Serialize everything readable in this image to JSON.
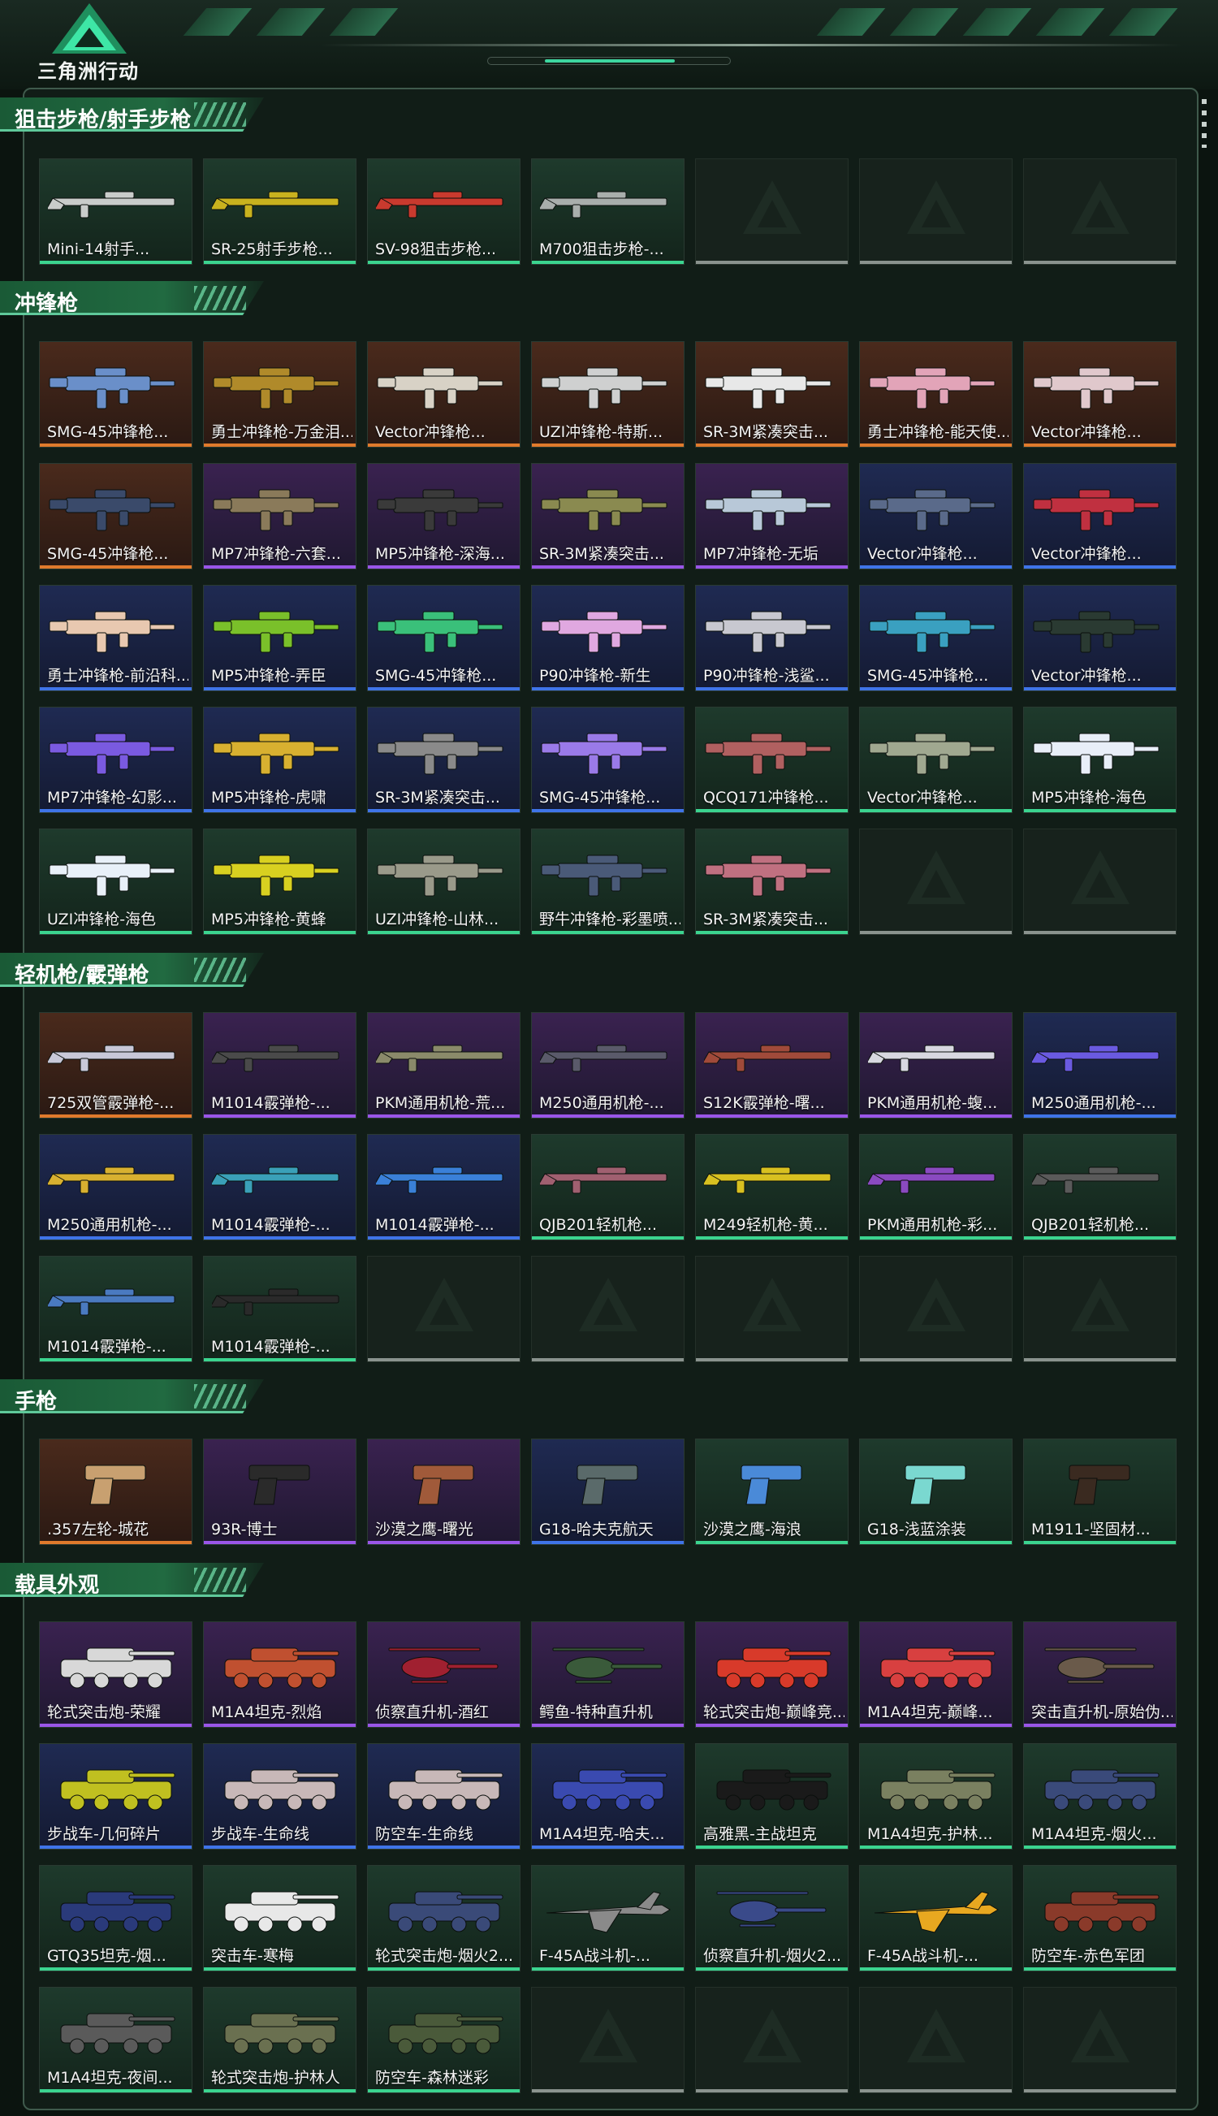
{
  "app": {
    "brand": "三角洲行动",
    "logo_icon": "delta-triangle-logo-icon"
  },
  "colors": {
    "accent": "#3bd48f",
    "orange": "#e07a2c",
    "purple": "#9a56e8",
    "blue": "#3f74e8",
    "green": "#3bd48f"
  },
  "sections": [
    {
      "title": "狙击步枪/射手步枪",
      "items": [
        {
          "name": "Mini-14射手...",
          "rarity": "green",
          "kind": "rifle",
          "color": "#c9ccca"
        },
        {
          "name": "SR-25射手步枪...",
          "rarity": "green",
          "kind": "rifle",
          "color": "#c9b21e"
        },
        {
          "name": "SV-98狙击步枪...",
          "rarity": "green",
          "kind": "rifle",
          "color": "#c93a2e"
        },
        {
          "name": "M700狙击步枪-...",
          "rarity": "green",
          "kind": "rifle",
          "color": "#a9aeac"
        },
        {
          "name": "",
          "rarity": "empty"
        },
        {
          "name": "",
          "rarity": "empty"
        },
        {
          "name": "",
          "rarity": "empty"
        }
      ]
    },
    {
      "title": "冲锋枪",
      "items": [
        {
          "name": "SMG-45冲锋枪...",
          "rarity": "orange",
          "kind": "smg",
          "color": "#6a8fc9"
        },
        {
          "name": "勇士冲锋枪-万金泪...",
          "rarity": "orange",
          "kind": "smg",
          "color": "#b08a2a"
        },
        {
          "name": "Vector冲锋枪...",
          "rarity": "orange",
          "kind": "smg",
          "color": "#d8d2c6"
        },
        {
          "name": "UZI冲锋枪-特斯...",
          "rarity": "orange",
          "kind": "smg",
          "color": "#cfd0d0"
        },
        {
          "name": "SR-3M紧凑突击...",
          "rarity": "orange",
          "kind": "smg",
          "color": "#e8e8e8"
        },
        {
          "name": "勇士冲锋枪-能天使...",
          "rarity": "orange",
          "kind": "smg",
          "color": "#e2a4b8"
        },
        {
          "name": "Vector冲锋枪...",
          "rarity": "orange",
          "kind": "smg",
          "color": "#e0c8cc"
        },
        {
          "name": "SMG-45冲锋枪...",
          "rarity": "orange",
          "kind": "smg",
          "color": "#3a4a6a"
        },
        {
          "name": "MP7冲锋枪-六套...",
          "rarity": "purple",
          "kind": "smg",
          "color": "#8a7a5a"
        },
        {
          "name": "MP5冲锋枪-深海...",
          "rarity": "purple",
          "kind": "smg",
          "color": "#3a3a3a"
        },
        {
          "name": "SR-3M紧凑突击...",
          "rarity": "purple",
          "kind": "smg",
          "color": "#8a8a50"
        },
        {
          "name": "MP7冲锋枪-无垢",
          "rarity": "purple",
          "kind": "smg",
          "color": "#b8c8d8"
        },
        {
          "name": "Vector冲锋枪...",
          "rarity": "blue",
          "kind": "smg",
          "color": "#5a6a8a"
        },
        {
          "name": "Vector冲锋枪...",
          "rarity": "blue",
          "kind": "smg",
          "color": "#c03040"
        },
        {
          "name": "勇士冲锋枪-前沿科...",
          "rarity": "blue",
          "kind": "smg",
          "color": "#e8c8b0"
        },
        {
          "name": "MP5冲锋枪-弄臣",
          "rarity": "blue",
          "kind": "smg",
          "color": "#7ac02a"
        },
        {
          "name": "SMG-45冲锋枪...",
          "rarity": "blue",
          "kind": "smg",
          "color": "#3ac07a"
        },
        {
          "name": "P90冲锋枪-新生",
          "rarity": "blue",
          "kind": "smg",
          "color": "#e0a8e0"
        },
        {
          "name": "P90冲锋枪-浅鲨...",
          "rarity": "blue",
          "kind": "smg",
          "color": "#c8c8d0"
        },
        {
          "name": "SMG-45冲锋枪...",
          "rarity": "blue",
          "kind": "smg",
          "color": "#3aa0c0"
        },
        {
          "name": "Vector冲锋枪...",
          "rarity": "blue",
          "kind": "smg",
          "color": "#2a3a32"
        },
        {
          "name": "MP7冲锋枪-幻影...",
          "rarity": "blue",
          "kind": "smg",
          "color": "#7a5ae0"
        },
        {
          "name": "MP5冲锋枪-虎啸",
          "rarity": "blue",
          "kind": "smg",
          "color": "#d8b030"
        },
        {
          "name": "SR-3M紧凑突击...",
          "rarity": "blue",
          "kind": "smg",
          "color": "#8a8a8a"
        },
        {
          "name": "SMG-45冲锋枪...",
          "rarity": "blue",
          "kind": "smg",
          "color": "#9a7ae8"
        },
        {
          "name": "QCQ171冲锋枪...",
          "rarity": "green",
          "kind": "smg",
          "color": "#b06060"
        },
        {
          "name": "Vector冲锋枪...",
          "rarity": "green",
          "kind": "smg",
          "color": "#a0a890"
        },
        {
          "name": "MP5冲锋枪-海色",
          "rarity": "green",
          "kind": "smg",
          "color": "#e8eef8"
        },
        {
          "name": "UZI冲锋枪-海色",
          "rarity": "green",
          "kind": "smg",
          "color": "#e8f0f8"
        },
        {
          "name": "MP5冲锋枪-黄蜂",
          "rarity": "green",
          "kind": "smg",
          "color": "#d8d020"
        },
        {
          "name": "UZI冲锋枪-山林...",
          "rarity": "green",
          "kind": "smg",
          "color": "#9a9a8a"
        },
        {
          "name": "野牛冲锋枪-彩墨喷...",
          "rarity": "green",
          "kind": "smg",
          "color": "#4a5a78"
        },
        {
          "name": "SR-3M紧凑突击...",
          "rarity": "green",
          "kind": "smg",
          "color": "#c07080"
        },
        {
          "name": "",
          "rarity": "empty"
        },
        {
          "name": "",
          "rarity": "empty"
        }
      ]
    },
    {
      "title": "轻机枪/霰弹枪",
      "items": [
        {
          "name": "725双管霰弹枪-...",
          "rarity": "orange",
          "kind": "rifle",
          "color": "#c8c8d8"
        },
        {
          "name": "M1014霰弹枪-...",
          "rarity": "purple",
          "kind": "rifle",
          "color": "#4a4a4a"
        },
        {
          "name": "PKM通用机枪-荒...",
          "rarity": "purple",
          "kind": "rifle",
          "color": "#8a8a6a"
        },
        {
          "name": "M250通用机枪-...",
          "rarity": "purple",
          "kind": "rifle",
          "color": "#5a5a6a"
        },
        {
          "name": "S12K霰弹枪-曙...",
          "rarity": "purple",
          "kind": "rifle",
          "color": "#a04a3a"
        },
        {
          "name": "PKM通用机枪-蝮...",
          "rarity": "purple",
          "kind": "rifle",
          "color": "#d8d8e0"
        },
        {
          "name": "M250通用机枪-...",
          "rarity": "blue",
          "kind": "rifle",
          "color": "#6a5ae0"
        },
        {
          "name": "M250通用机枪-...",
          "rarity": "blue",
          "kind": "rifle",
          "color": "#d8b030"
        },
        {
          "name": "M1014霰弹枪-...",
          "rarity": "blue",
          "kind": "rifle",
          "color": "#3aa0b8"
        },
        {
          "name": "M1014霰弹枪-...",
          "rarity": "blue",
          "kind": "rifle",
          "color": "#3a80d8"
        },
        {
          "name": "QJB201轻机枪...",
          "rarity": "green",
          "kind": "rifle",
          "color": "#a06070"
        },
        {
          "name": "M249轻机枪-黄...",
          "rarity": "green",
          "kind": "rifle",
          "color": "#d8c020"
        },
        {
          "name": "PKM通用机枪-彩...",
          "rarity": "green",
          "kind": "rifle",
          "color": "#8a4ac0"
        },
        {
          "name": "QJB201轻机枪...",
          "rarity": "green",
          "kind": "rifle",
          "color": "#5a5a5a"
        },
        {
          "name": "M1014霰弹枪-...",
          "rarity": "green",
          "kind": "rifle",
          "color": "#4a7ac0"
        },
        {
          "name": "M1014霰弹枪-...",
          "rarity": "green",
          "kind": "rifle",
          "color": "#2a2a2a"
        },
        {
          "name": "",
          "rarity": "empty"
        },
        {
          "name": "",
          "rarity": "empty"
        },
        {
          "name": "",
          "rarity": "empty"
        },
        {
          "name": "",
          "rarity": "empty"
        },
        {
          "name": "",
          "rarity": "empty"
        }
      ]
    },
    {
      "title": "手枪",
      "items": [
        {
          "name": ".357左轮-城花",
          "rarity": "orange",
          "kind": "pistol",
          "color": "#c8a070"
        },
        {
          "name": "93R-博士",
          "rarity": "purple",
          "kind": "pistol",
          "color": "#2a2a2a"
        },
        {
          "name": "沙漠之鹰-曙光",
          "rarity": "purple",
          "kind": "pistol",
          "color": "#a05a3a"
        },
        {
          "name": "G18-哈夫克航天",
          "rarity": "blue",
          "kind": "pistol",
          "color": "#5a6a6a"
        },
        {
          "name": "沙漠之鹰-海浪",
          "rarity": "green",
          "kind": "pistol",
          "color": "#4a8ad8"
        },
        {
          "name": "G18-浅蓝涂装",
          "rarity": "green",
          "kind": "pistol",
          "color": "#7ad8d0"
        },
        {
          "name": "M1911-坚固材...",
          "rarity": "green",
          "kind": "pistol",
          "color": "#3a2a20"
        }
      ]
    },
    {
      "title": "载具外观",
      "items": [
        {
          "name": "轮式突击炮-荣耀",
          "rarity": "purple",
          "kind": "vehicle",
          "color": "#d8d8d8"
        },
        {
          "name": "M1A4坦克-烈焰",
          "rarity": "purple",
          "kind": "vehicle",
          "color": "#c05030"
        },
        {
          "name": "侦察直升机-酒红",
          "rarity": "purple",
          "kind": "heli",
          "color": "#a02030"
        },
        {
          "name": "鳄鱼-特种直升机",
          "rarity": "purple",
          "kind": "heli",
          "color": "#3a5a3a"
        },
        {
          "name": "轮式突击炮-巅峰竞...",
          "rarity": "purple",
          "kind": "vehicle",
          "color": "#d83a2a"
        },
        {
          "name": "M1A4坦克-巅峰...",
          "rarity": "purple",
          "kind": "vehicle",
          "color": "#d84040"
        },
        {
          "name": "突击直升机-原始伪...",
          "rarity": "purple",
          "kind": "heli",
          "color": "#6a5a4a"
        },
        {
          "name": "步战车-几何碎片",
          "rarity": "blue",
          "kind": "vehicle",
          "color": "#c0c020"
        },
        {
          "name": "步战车-生命线",
          "rarity": "blue",
          "kind": "vehicle",
          "color": "#c8b8b8"
        },
        {
          "name": "防空车-生命线",
          "rarity": "blue",
          "kind": "vehicle",
          "color": "#c8b8b8"
        },
        {
          "name": "M1A4坦克-哈夫...",
          "rarity": "blue",
          "kind": "vehicle",
          "color": "#3a4ab0"
        },
        {
          "name": "高雅黑-主战坦克",
          "rarity": "green",
          "kind": "vehicle",
          "color": "#1a1a1a"
        },
        {
          "name": "M1A4坦克-护林...",
          "rarity": "green",
          "kind": "vehicle",
          "color": "#7a8060"
        },
        {
          "name": "M1A4坦克-烟火...",
          "rarity": "green",
          "kind": "vehicle",
          "color": "#3a4a7a"
        },
        {
          "name": "GTQ35坦克-烟...",
          "rarity": "green",
          "kind": "vehicle",
          "color": "#2a3a7a"
        },
        {
          "name": "突击车-寒梅",
          "rarity": "green",
          "kind": "vehicle",
          "color": "#e8e8e8"
        },
        {
          "name": "轮式突击炮-烟火2...",
          "rarity": "green",
          "kind": "vehicle",
          "color": "#3a4a78"
        },
        {
          "name": "F-45A战斗机-...",
          "rarity": "green",
          "kind": "jet",
          "color": "#8a8a8a"
        },
        {
          "name": "侦察直升机-烟火2...",
          "rarity": "green",
          "kind": "heli",
          "color": "#3a4a8a"
        },
        {
          "name": "F-45A战斗机-...",
          "rarity": "green",
          "kind": "jet",
          "color": "#e8a820"
        },
        {
          "name": "防空车-赤色军团",
          "rarity": "green",
          "kind": "vehicle",
          "color": "#8a3a2a"
        },
        {
          "name": "M1A4坦克-夜间...",
          "rarity": "green",
          "kind": "vehicle",
          "color": "#5a5a5a"
        },
        {
          "name": "轮式突击炮-护林人",
          "rarity": "green",
          "kind": "vehicle",
          "color": "#6a7050"
        },
        {
          "name": "防空车-森林迷彩",
          "rarity": "green",
          "kind": "vehicle",
          "color": "#4a5a3a"
        },
        {
          "name": "",
          "rarity": "empty"
        },
        {
          "name": "",
          "rarity": "empty"
        },
        {
          "name": "",
          "rarity": "empty"
        },
        {
          "name": "",
          "rarity": "empty"
        }
      ]
    }
  ]
}
